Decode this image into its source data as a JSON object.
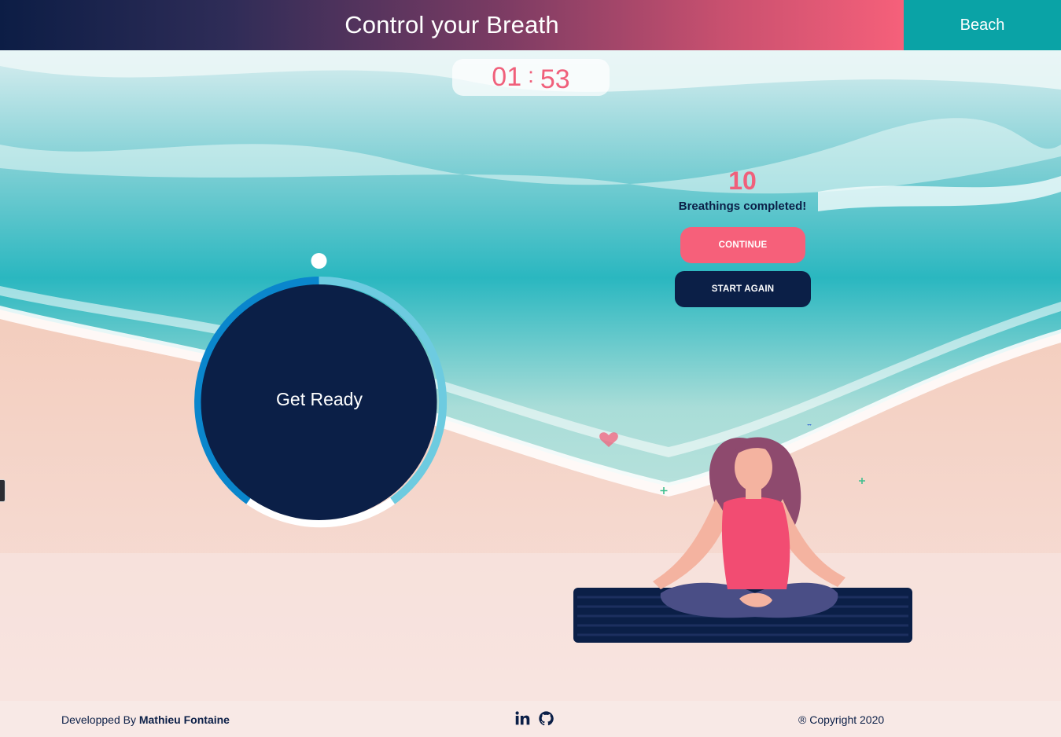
{
  "header": {
    "title": "Control your Breath",
    "theme_button": "Beach"
  },
  "timer": {
    "minutes": "01",
    "separator": ":",
    "seconds": "53"
  },
  "breath_circle": {
    "label": "Get Ready"
  },
  "completed": {
    "count": "10",
    "text": "Breathings completed!",
    "continue_label": "CONTINUE",
    "start_again_label": "START AGAIN"
  },
  "footer": {
    "credit_prefix": "Developped By",
    "credit_name": "Mathieu Fontaine",
    "copyright": "® Copyright 2020",
    "social_icons": [
      "linkedin-icon",
      "github-icon"
    ]
  },
  "colors": {
    "accent_pink": "#f6607a",
    "navy": "#0b1f47",
    "teal": "#0aa3a6",
    "ring_blue": "#0a86cc",
    "ring_light": "#6dcbe0"
  }
}
